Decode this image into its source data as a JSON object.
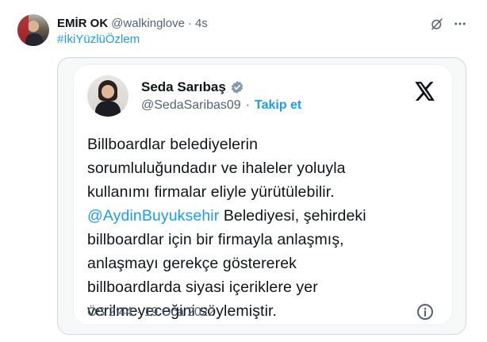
{
  "post": {
    "display_name": "EMİR OK",
    "handle": "@walkinglove",
    "separator": "·",
    "time": "4s",
    "hashtag": "#İkiYüzlüÖzlem",
    "icons": {
      "grok": "grok-icon",
      "more": "more-icon"
    }
  },
  "embedded_card": {
    "name": "Seda Sarıbaş",
    "verified": true,
    "handle": "@SedaSaribas09",
    "separator": "·",
    "follow_label": "Takip et",
    "text_lines": [
      "Billboardlar belediyelerin",
      "sorumluluğundadır ve ihaleler yoluyla",
      "kullanımı firmalar eliyle yürütülebilir.",
      "Belediyesi, şehirdeki",
      "billboardlar için bir firmayla anlaşmış,",
      "anlaşmayı gerekçe göstererek",
      "billboardlarda siyasi içeriklere yer",
      "verilmeyeceğini söylemiştir."
    ],
    "mention": "@AydinBuyuksehir",
    "time": "ÖS 2:44",
    "date_separator": "·",
    "date": "19 Oca 2022",
    "icons": {
      "brand": "x-logo-icon",
      "verified": "verified-badge-icon",
      "info": "info-icon"
    }
  },
  "colors": {
    "link": "#1d9bf0",
    "text": "#0f1419",
    "muted": "#536471",
    "border": "#cfd9de",
    "media_bg": "#f7f9f9"
  }
}
